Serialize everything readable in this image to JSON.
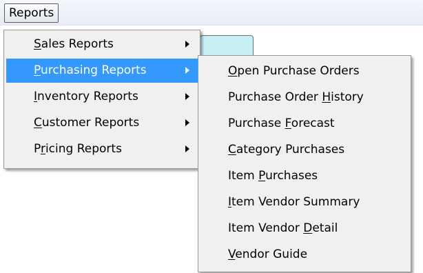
{
  "menubar": {
    "reports_label": "Reports"
  },
  "main_menu": {
    "items": [
      {
        "pre": "",
        "key": "S",
        "post": "ales Reports",
        "has_submenu": true,
        "highlighted": false
      },
      {
        "pre": "",
        "key": "P",
        "post": "urchasing Reports",
        "has_submenu": true,
        "highlighted": true
      },
      {
        "pre": "",
        "key": "I",
        "post": "nventory Reports",
        "has_submenu": true,
        "highlighted": false
      },
      {
        "pre": "",
        "key": "C",
        "post": "ustomer Reports",
        "has_submenu": true,
        "highlighted": false
      },
      {
        "pre": "P",
        "key": "r",
        "post": "icing Reports",
        "has_submenu": true,
        "highlighted": false
      }
    ]
  },
  "submenu": {
    "items": [
      {
        "pre": "",
        "key": "O",
        "post": "pen Purchase Orders"
      },
      {
        "pre": "Purchase Order ",
        "key": "H",
        "post": "istory"
      },
      {
        "pre": "Purchase ",
        "key": "F",
        "post": "orecast"
      },
      {
        "pre": "",
        "key": "C",
        "post": "ategory Purchases"
      },
      {
        "pre": "Item ",
        "key": "P",
        "post": "urchases"
      },
      {
        "pre": "",
        "key": "I",
        "post": "tem Vendor Summary"
      },
      {
        "pre": "Item Vendor ",
        "key": "D",
        "post": "etail"
      },
      {
        "pre": "",
        "key": "V",
        "post": "endor Guide"
      }
    ]
  },
  "colors": {
    "highlight": "#3399ff",
    "menu_bg": "#f0f0f0",
    "field_bg": "#c7f0f5"
  }
}
